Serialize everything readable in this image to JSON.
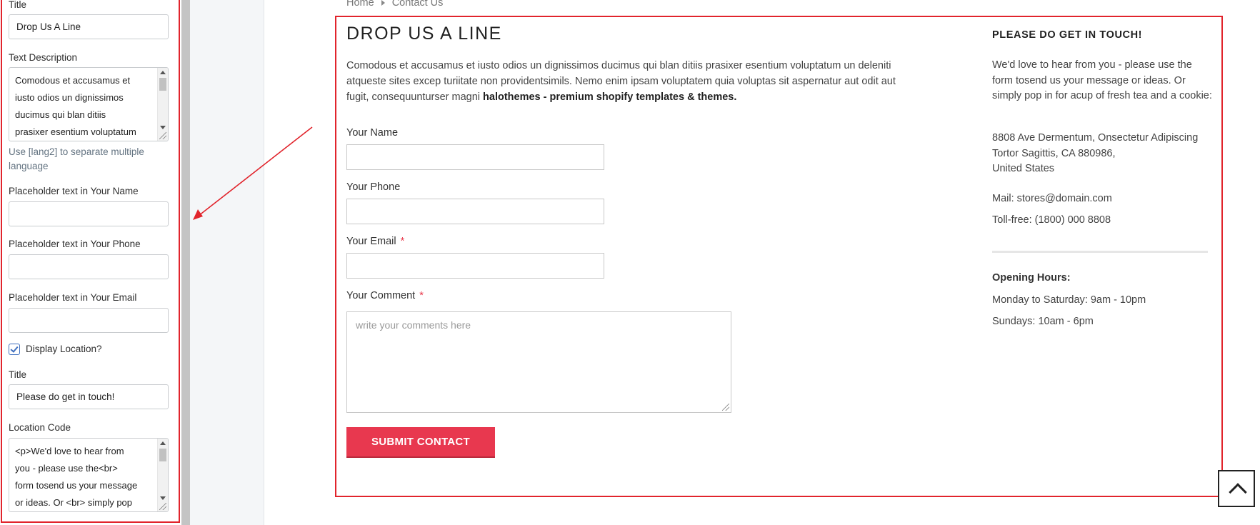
{
  "settings_panel": {
    "title_label": "Title",
    "title_value": "Drop Us A Line",
    "text_description_label": "Text Description",
    "text_description_value": "Comodous et accusamus et\niusto odios un dignissimos\nducimus qui blan ditiis\nprasixer esentium voluptatum",
    "lang_hint": "Use [lang2] to separate multiple language",
    "placeholder_name_label": "Placeholder text in Your Name",
    "placeholder_name_value": "",
    "placeholder_phone_label": "Placeholder text in Your Phone",
    "placeholder_phone_value": "",
    "placeholder_email_label": "Placeholder text in Your Email",
    "placeholder_email_value": "",
    "display_location_label": "Display Location?",
    "display_location_checked": true,
    "location_title_label": "Title",
    "location_title_value": "Please do get in touch!",
    "location_code_label": "Location Code",
    "location_code_value": "<p>We'd love to hear from\nyou - please use the<br>\nform tosend us your message\nor ideas. Or <br> simply pop"
  },
  "preview": {
    "breadcrumb": [
      "Home",
      "Contact Us"
    ],
    "title": "Drop Us A Line",
    "intro_text": "Comodous et accusamus et iusto odios un dignissimos ducimus qui blan ditiis prasixer esentium voluptatum un deleniti atqueste sites excep turiitate non providentsimils. Nemo enim ipsam voluptatem quia voluptas sit aspernatur aut odit aut fugit, consequunturser magni ",
    "intro_bold": "halothemes - premium shopify templates & themes.",
    "form": {
      "name_label": "Your Name",
      "phone_label": "Your Phone",
      "email_label": "Your Email",
      "comment_label": "Your Comment",
      "required_mark": "*",
      "comment_placeholder": "write your comments here",
      "submit_label": "Submit Contact"
    },
    "sidebar": {
      "title": "Please do get in touch!",
      "intro": "We'd love to hear from you - please use the form tosend us your message or ideas. Or simply pop in for acup of fresh tea and a cookie:",
      "address": "8808 Ave Dermentum, Onsectetur Adipiscing\nTortor Sagittis, CA 880986,\nUnited States",
      "mail": "Mail: stores@domain.com",
      "tollfree": "Toll-free: (1800) 000 8808",
      "hours_title": "Opening Hours:",
      "hours_weekdays": "Monday to Saturday: 9am - 10pm",
      "hours_sunday": "Sundays: 10am - 6pm"
    }
  },
  "colors": {
    "highlight_border": "#e1242c",
    "submit_button": "#e8384f",
    "required_star": "#e8374a",
    "checkbox": "#3f6fbf"
  },
  "icons": {
    "breadcrumb_separator": "caret-right-icon",
    "back_to_top": "chevron-up-icon",
    "checkbox": "checkmark-icon"
  }
}
